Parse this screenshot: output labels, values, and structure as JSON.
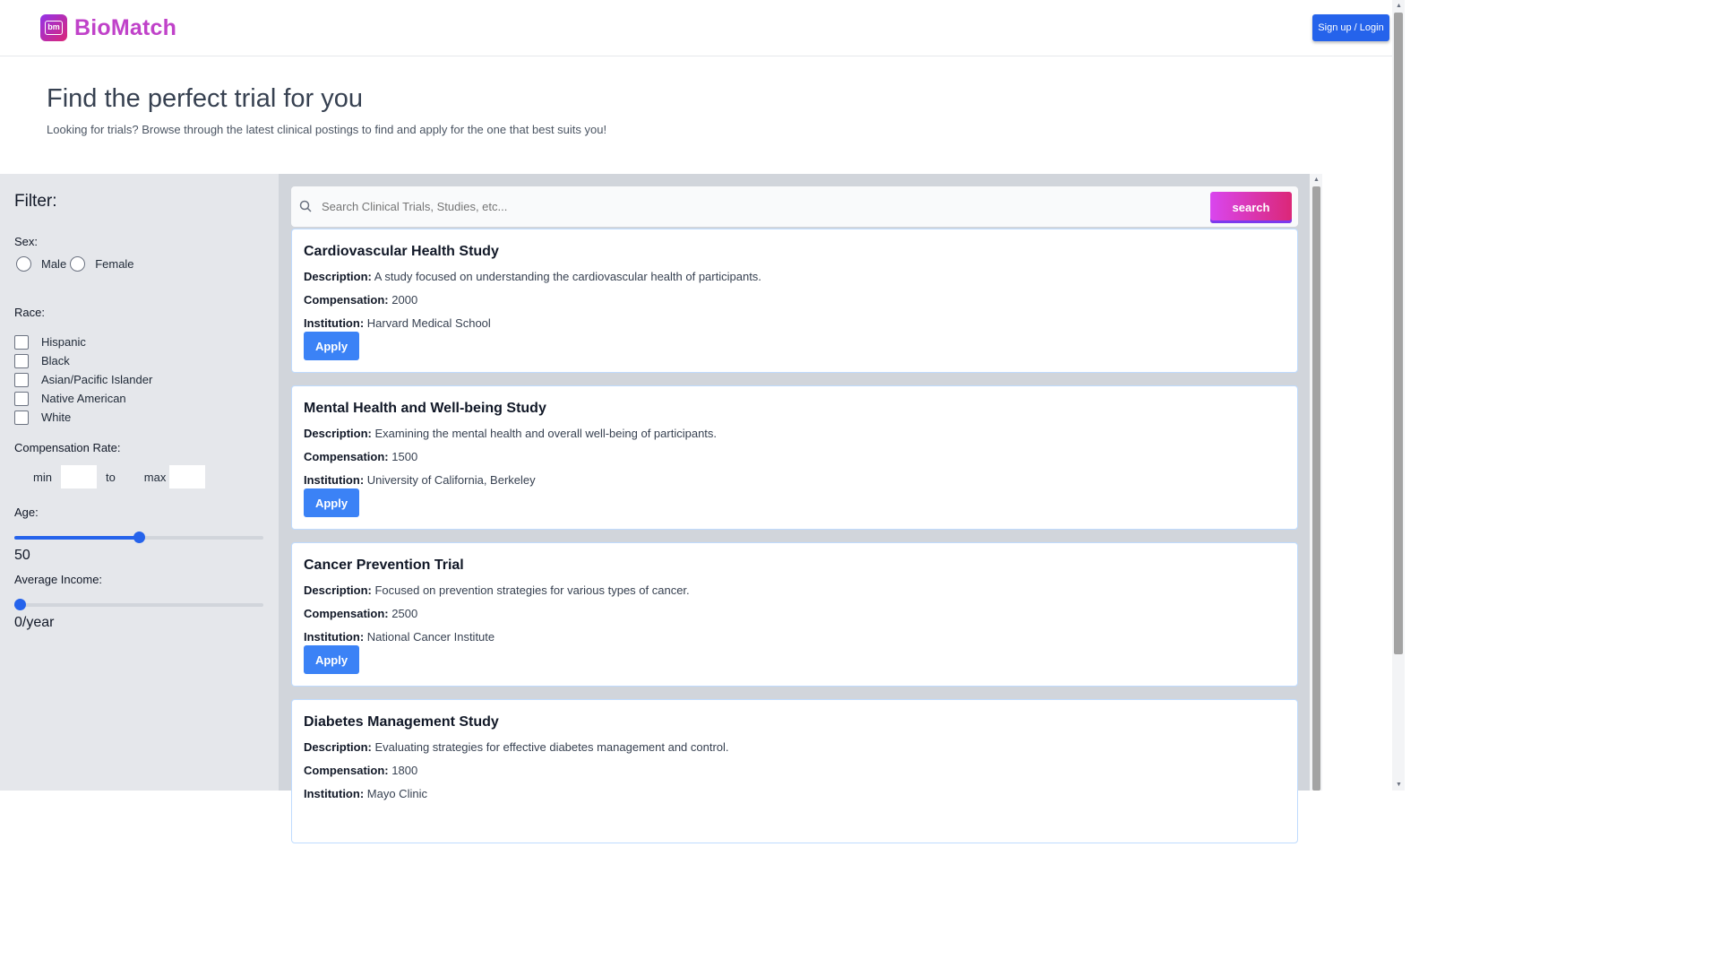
{
  "header": {
    "logo_text": "BioMatch",
    "logo_badge": "bm",
    "signup_label": "Sign up / Login"
  },
  "hero": {
    "title": "Find the perfect trial for you",
    "subtitle": "Looking for trials? Browse through the latest clinical postings to find and apply for the one that best suits you!"
  },
  "filter": {
    "title": "Filter:",
    "sex_label": "Sex:",
    "sex_options": [
      "Male",
      "Female"
    ],
    "race_label": "Race:",
    "race_options": [
      "Hispanic",
      "Black",
      "Asian/Pacific Islander",
      "Native American",
      "White"
    ],
    "compensation_label": "Compensation Rate:",
    "comp_min_label": "min",
    "comp_to_label": "to",
    "comp_max_label": "max",
    "age_label": "Age:",
    "age_value": "50",
    "income_label": "Average Income:",
    "income_value": "0/year"
  },
  "search": {
    "placeholder": "Search Clinical Trials, Studies, etc...",
    "button_label": "search"
  },
  "labels": {
    "description": "Description:",
    "compensation": "Compensation:",
    "institution": "Institution:",
    "apply": "Apply"
  },
  "trials": [
    {
      "title": "Cardiovascular Health Study",
      "description": "A study focused on understanding the cardiovascular health of participants.",
      "compensation": "2000",
      "institution": "Harvard Medical School"
    },
    {
      "title": "Mental Health and Well-being Study",
      "description": "Examining the mental health and overall well-being of participants.",
      "compensation": "1500",
      "institution": "University of California, Berkeley"
    },
    {
      "title": "Cancer Prevention Trial",
      "description": "Focused on prevention strategies for various types of cancer.",
      "compensation": "2500",
      "institution": "National Cancer Institute"
    },
    {
      "title": "Diabetes Management Study",
      "description": "Evaluating strategies for effective diabetes management and control.",
      "compensation": "1800",
      "institution": "Mayo Clinic"
    }
  ],
  "colors": {
    "brand_gradient_start": "#9333ea",
    "brand_gradient_end": "#db2777",
    "primary_button": "#3b82f6",
    "signup_button": "#2563eb"
  },
  "icons": {
    "search": "search-icon",
    "logo": "logo-icon"
  }
}
